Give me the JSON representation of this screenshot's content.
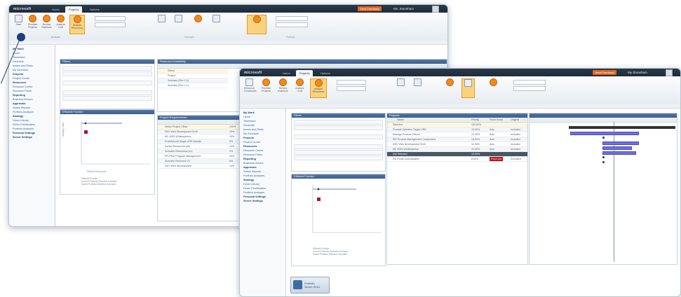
{
  "screen_a": {
    "brand": "microsoft",
    "tabs": [
      "Home",
      "Projects",
      "Options"
    ],
    "active_tab": 1,
    "feedback_label": "Send Feedback",
    "user_label": "Ms. Stoneham",
    "ribbon_buttons": [
      "Save",
      "Prioritize Projects",
      "Review Business",
      "Analyze Cost",
      "Analyze Resources"
    ],
    "groups": [
      "Analysis",
      "Scenario",
      "Portfolio"
    ],
    "nav_items": [
      {
        "label": "My Work",
        "hd": true
      },
      {
        "label": "Home"
      },
      {
        "label": "Timesheet"
      },
      {
        "label": "Schedule"
      },
      {
        "label": "Issues and Risks"
      },
      {
        "label": "My Schedule"
      },
      {
        "label": "Projects",
        "hd": true
      },
      {
        "label": "Project Center"
      },
      {
        "label": "Resources",
        "hd": true
      },
      {
        "label": "Resource Center"
      },
      {
        "label": "Resource Plans"
      },
      {
        "label": "Reporting",
        "hd": true
      },
      {
        "label": "Business Drivers"
      },
      {
        "label": "Approvals",
        "hd": true
      },
      {
        "label": "Status Reports"
      },
      {
        "label": "Portfolio Analyses"
      },
      {
        "label": "Strategy",
        "hd": true
      },
      {
        "label": "Driver Library"
      },
      {
        "label": "Driver Prioritization"
      },
      {
        "label": "Portfolio Analyses"
      },
      {
        "label": "Personal Settings",
        "hd": true
      },
      {
        "label": "Server Settings",
        "hd": true
      }
    ],
    "filters_title": "Filters",
    "analysis_title": "Efficient Frontier",
    "requirements_title": "Resource Availability",
    "resource_rows": [
      "Select",
      "Project",
      "Scenario (Rev 1.0)",
      "Scenario (Rev 1.1)"
    ],
    "req_title": "Project Requirements",
    "req_rows": [
      "Select Project Office",
      "DEV Web Development 0100",
      "MC MSS Whitetopinion",
      "Professional Single-VRE Actuals",
      "Sorted Resources (all)",
      "Scenario Resources (v1)",
      "PR-PMO Program Management",
      "Scenario Resource V1",
      "DEV Web Development"
    ],
    "req_values": [
      "100%",
      "25%",
      "15%",
      "5%",
      "10%",
      "3%",
      "20%",
      "8%",
      "14%"
    ],
    "legend": [
      "Efficient Frontier",
      "Current Portfolio Selection Scenario",
      "Saved Portfolio Selection Scenario"
    ],
    "axis_x": "Efficient Resources",
    "axis_y": "Strategic value"
  },
  "screen_b": {
    "brand": "microsoft",
    "tabs": [
      "Home",
      "Projects",
      "Options"
    ],
    "active_tab": 1,
    "feedback_label": "Send Feedback",
    "user_label": "My Stoneham",
    "ribbon_buttons": [
      "Resource Constraints",
      "Prioritize Projects",
      "Review Business",
      "Analyze Cost",
      "Analyze Resources"
    ],
    "filters_title": "Filters",
    "projects_title": "Projects",
    "analysis_title": "Efficient Frontier",
    "columns": [
      "Name",
      "Priority",
      "Force in/out",
      "Original"
    ],
    "rows": [
      {
        "name": "Selected",
        "priority": "100.00%",
        "force": "",
        "orig": "",
        "kind": "sum"
      },
      {
        "name": "Product Selection Single-VRE",
        "priority": "15.00%",
        "force": "Auto",
        "orig": "Included",
        "kind": "alt"
      },
      {
        "name": "Manage Product Offices",
        "priority": "12.00%",
        "force": "Auto",
        "orig": "Included",
        "kind": ""
      },
      {
        "name": "PIR Product Management Component",
        "priority": "18.00%",
        "force": "Auto",
        "orig": "Included",
        "kind": "alt"
      },
      {
        "name": "DEV Web Development 0100",
        "priority": "11.00%",
        "force": "Auto",
        "orig": "Included",
        "kind": ""
      },
      {
        "name": "MC MSS Whitetopinion",
        "priority": "10.00%",
        "force": "Auto",
        "orig": "Included",
        "kind": "alt"
      },
      {
        "name": "Not Selected",
        "priority": "10.00%",
        "force": "",
        "orig": "",
        "kind": "dark"
      },
      {
        "name": "RD Portal Consolidation",
        "priority": "8.00%",
        "force": "Force out",
        "orig": "Excluded",
        "kind": "red"
      }
    ],
    "badge_line1": "Portfolio",
    "badge_line2": "Server 2010"
  }
}
